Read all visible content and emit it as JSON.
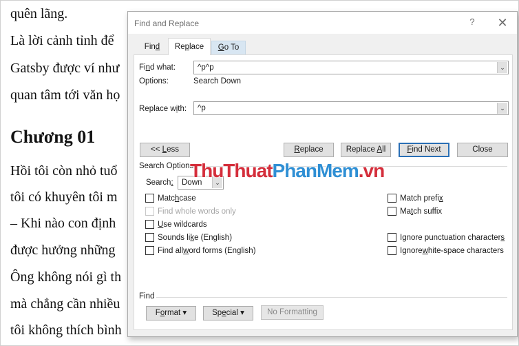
{
  "document": {
    "lines": [
      "quên lãng.",
      "Là lời cảnh tỉnh để",
      "Gatsby được ví như",
      "quan tâm tới văn họ",
      "Hồi tôi còn nhỏ tuổ",
      "tôi có khuyên tôi m",
      "– Khi nào con định",
      "được hưởng những",
      "Ông không nói gì th",
      "mà chẳng cần nhiều",
      "tôi không thích bình"
    ],
    "heading": "Chương 01"
  },
  "dialog": {
    "title": "Find and Replace",
    "help_label": "?",
    "close_label": "✕",
    "tabs": {
      "find": {
        "pre": "Fin",
        "key": "d",
        "post": ""
      },
      "replace": {
        "pre": "Re",
        "key": "p",
        "post": "lace"
      },
      "goto": {
        "pre": "",
        "key": "G",
        "post": "o To"
      }
    },
    "find_what": {
      "label_pre": "Fi",
      "label_key": "n",
      "label_post": "d what:",
      "value": "^p^p"
    },
    "options": {
      "label": "Options:",
      "value": "Search Down"
    },
    "replace_with": {
      "label_pre": "Replace w",
      "label_key": "i",
      "label_post": "th:",
      "value": "^p"
    },
    "buttons": {
      "less": {
        "pre": "<< ",
        "key": "L",
        "post": "ess"
      },
      "replace": {
        "pre": "",
        "key": "R",
        "post": "eplace"
      },
      "replace_all": {
        "pre": "Replace ",
        "key": "A",
        "post": "ll"
      },
      "find_next": {
        "pre": "",
        "key": "F",
        "post": "ind Next"
      },
      "close": "Close"
    },
    "search_options": {
      "title": "Search Options",
      "search_label_pre": "Search",
      "search_label_key": ":",
      "search_value": "Down"
    },
    "checkboxes_left": [
      {
        "pre": "Matc",
        "key": "h",
        "post": " case",
        "checked": false,
        "disabled": false
      },
      {
        "pre": "Find whole words only",
        "key": "",
        "post": "",
        "checked": false,
        "disabled": true
      },
      {
        "pre": "",
        "key": "U",
        "post": "se wildcards",
        "checked": false,
        "disabled": false
      },
      {
        "pre": "Sounds li",
        "key": "k",
        "post": "e (English)",
        "checked": false,
        "disabled": false
      },
      {
        "pre": "Find all ",
        "key": "w",
        "post": "ord forms (English)",
        "checked": false,
        "disabled": false
      }
    ],
    "checkboxes_right": [
      {
        "pre": "Match prefi",
        "key": "x",
        "post": "",
        "checked": false
      },
      {
        "pre": "Ma",
        "key": "t",
        "post": "ch suffix",
        "checked": false
      },
      {
        "pre": "Ignore punctuation character",
        "key": "s",
        "post": "",
        "checked": false
      },
      {
        "pre": "Ignore ",
        "key": "w",
        "post": "hite-space characters",
        "checked": false
      }
    ],
    "find_group": {
      "title": "Find",
      "format": {
        "pre": "F",
        "key": "o",
        "post": "rmat"
      },
      "special": {
        "pre": "Sp",
        "key": "e",
        "post": "cial"
      },
      "dropdown_glyph": "▾",
      "no_formatting": "No Formatting"
    },
    "combo_arrow_glyph": "⌄"
  },
  "watermark": {
    "part1": "ThuThuat",
    "part2": "PhanMem",
    "part3": ".vn"
  },
  "colors": {
    "accent": "#2a6fb5",
    "watermark_red": "#d42e3b",
    "watermark_blue": "#2f8fd4"
  }
}
